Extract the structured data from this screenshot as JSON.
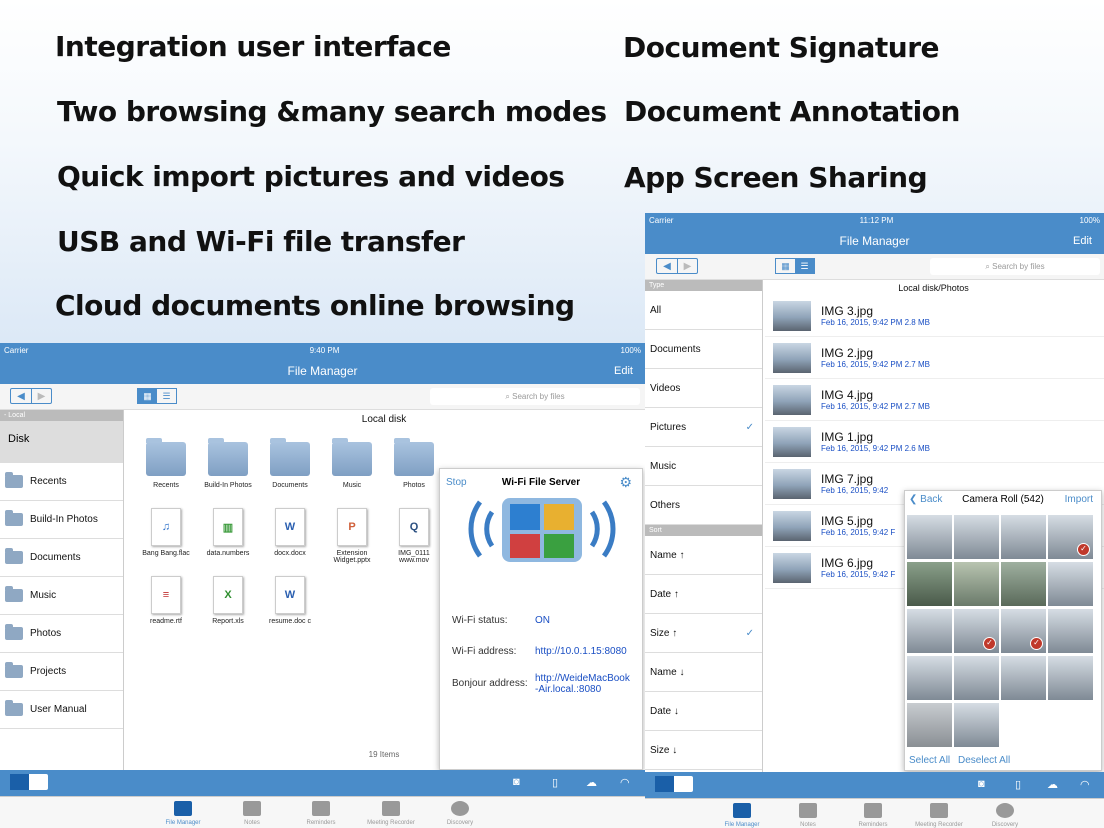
{
  "features_left": [
    "Integration user interface",
    "Two browsing &many search modes",
    "Quick import pictures and videos",
    "USB and Wi-Fi file transfer",
    "Cloud documents online browsing"
  ],
  "features_right": [
    "Document Signature",
    "Document Annotation",
    "App Screen Sharing"
  ],
  "left": {
    "carrier": "Carrier",
    "time": "9:40 PM",
    "battery": "100%",
    "title": "File Manager",
    "edit": "Edit",
    "search_placeholder": "Search by files",
    "section": "Local",
    "disk": "Disk",
    "sidebar": [
      "Recents",
      "Build-In Photos",
      "Documents",
      "Music",
      "Photos",
      "Projects",
      "User Manual"
    ],
    "heading": "Local disk",
    "folders": [
      "Recents",
      "Build-In Photos",
      "Documents",
      "Music",
      "Photos"
    ],
    "files": [
      "Bang Bang.flac",
      "data.numbers",
      "docx.docx",
      "Extension Widget.pptx",
      "IMG_0111 www.mov",
      "readme.rtf",
      "Report.xls",
      "resume.doc c"
    ],
    "count": "19 Items",
    "wifi": {
      "stop": "Stop",
      "title": "Wi-Fi File Server",
      "status_label": "Wi-Fi status:",
      "status_value": "ON",
      "address_label": "Wi-Fi address:",
      "address_value": "http://10.0.1.15:8080",
      "bonjour_label": "Bonjour address:",
      "bonjour_value": "http://WeideMacBook-Air.local.:8080"
    }
  },
  "right": {
    "carrier": "Carrier",
    "time": "11:12 PM",
    "battery": "100%",
    "title": "File Manager",
    "edit": "Edit",
    "search_placeholder": "Search by files",
    "type_label": "Type",
    "types": [
      "All",
      "Documents",
      "Videos",
      "Pictures",
      "Music",
      "Others"
    ],
    "sort_label": "Sort",
    "sorts": [
      "Name ↑",
      "Date ↑",
      "Size ↑",
      "Name ↓",
      "Date ↓",
      "Size ↓"
    ],
    "heading": "Local disk/Photos",
    "files": [
      {
        "name": "IMG 3.jpg",
        "meta": "Feb 16, 2015, 9:42 PM   2.8 MB"
      },
      {
        "name": "IMG 2.jpg",
        "meta": "Feb 16, 2015, 9:42 PM   2.7 MB"
      },
      {
        "name": "IMG 4.jpg",
        "meta": "Feb 16, 2015, 9:42 PM   2.7 MB"
      },
      {
        "name": "IMG 1.jpg",
        "meta": "Feb 16, 2015, 9:42 PM   2.6 MB"
      },
      {
        "name": "IMG 7.jpg",
        "meta": "Feb 16, 2015, 9:42"
      },
      {
        "name": "IMG 5.jpg",
        "meta": "Feb 16, 2015, 9:42 F"
      },
      {
        "name": "IMG 6.jpg",
        "meta": "Feb 16, 2015, 9:42 F"
      }
    ],
    "roll": {
      "back": "Back",
      "title": "Camera Roll (542)",
      "import": "Import",
      "select_all": "Select All",
      "deselect_all": "Deselect All"
    }
  },
  "tabs": [
    "File Manager",
    "Notes",
    "Reminders",
    "Meeting Recorder",
    "Discovery"
  ]
}
